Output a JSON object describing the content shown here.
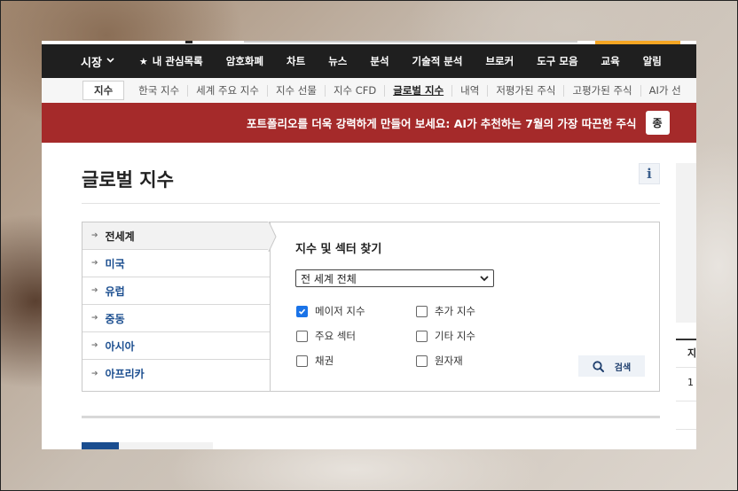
{
  "nav": {
    "market_label": "시장",
    "items": [
      "내 관심목록",
      "암호화폐",
      "차트",
      "뉴스",
      "분석",
      "기술적 분석",
      "브로커",
      "도구 모음",
      "교육",
      "알림"
    ]
  },
  "subnav": {
    "root": "지수",
    "items": [
      "한국 지수",
      "세계 주요 지수",
      "지수 선물",
      "지수 CFD",
      "글로벌 지수",
      "내역",
      "저평가된 주식",
      "고평가된 주식",
      "AI가 선"
    ]
  },
  "banner": {
    "text": "포트폴리오를 더욱 강력하게 만들어 보세요: AI가 추천하는 7월의 가장 따끈한 주식",
    "button": "종"
  },
  "page": {
    "title": "글로벌 지수",
    "info_glyph": "i"
  },
  "finder": {
    "regions": [
      "전세계",
      "미국",
      "유럽",
      "중동",
      "아시아",
      "아프리카"
    ],
    "title": "지수 및 섹터 찾기",
    "select_value": "전 세계 전체",
    "checkboxes": [
      {
        "label": "메이저 지수",
        "checked": true
      },
      {
        "label": "추가 지수",
        "checked": false
      },
      {
        "label": "주요 섹터",
        "checked": false
      },
      {
        "label": "기타 지수",
        "checked": false
      },
      {
        "label": "채권",
        "checked": false
      },
      {
        "label": "원자재",
        "checked": false
      }
    ],
    "search_label": "검색"
  },
  "side": {
    "row1": "지",
    "row2": "1"
  },
  "colors": {
    "nav_bg": "#1f1f1f",
    "banner_bg": "#a52a2a",
    "link": "#1a4d8f",
    "accent": "#f5a623"
  }
}
